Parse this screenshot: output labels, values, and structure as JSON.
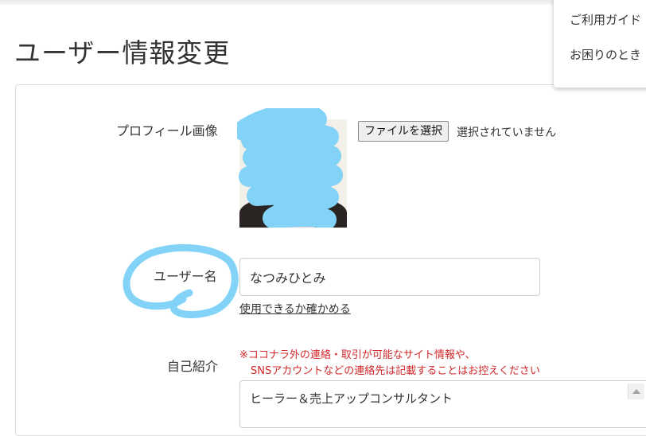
{
  "header": {
    "title": "ユーザー情報変更"
  },
  "menu": {
    "items": [
      "ご利用ガイド",
      "お困りのとき"
    ]
  },
  "form": {
    "profile_image": {
      "label": "プロフィール画像",
      "file_button": "ファイルを選択",
      "file_status": "選択されていません"
    },
    "username": {
      "label": "ユーザー名",
      "value": "なつみひとみ",
      "check_link": "使用できるか確かめる"
    },
    "bio": {
      "label": "自己紹介",
      "notice_line1": "※ココナラ外の連絡・取引が可能なサイト情報や、",
      "notice_line2": "SNSアカウントなどの連絡先は記載することはお控えください",
      "value": "ヒーラー＆売上アップコンサルタント"
    }
  },
  "colors": {
    "annotation": "#82d3f7",
    "notice": "#d1282a",
    "text": "#333333"
  }
}
